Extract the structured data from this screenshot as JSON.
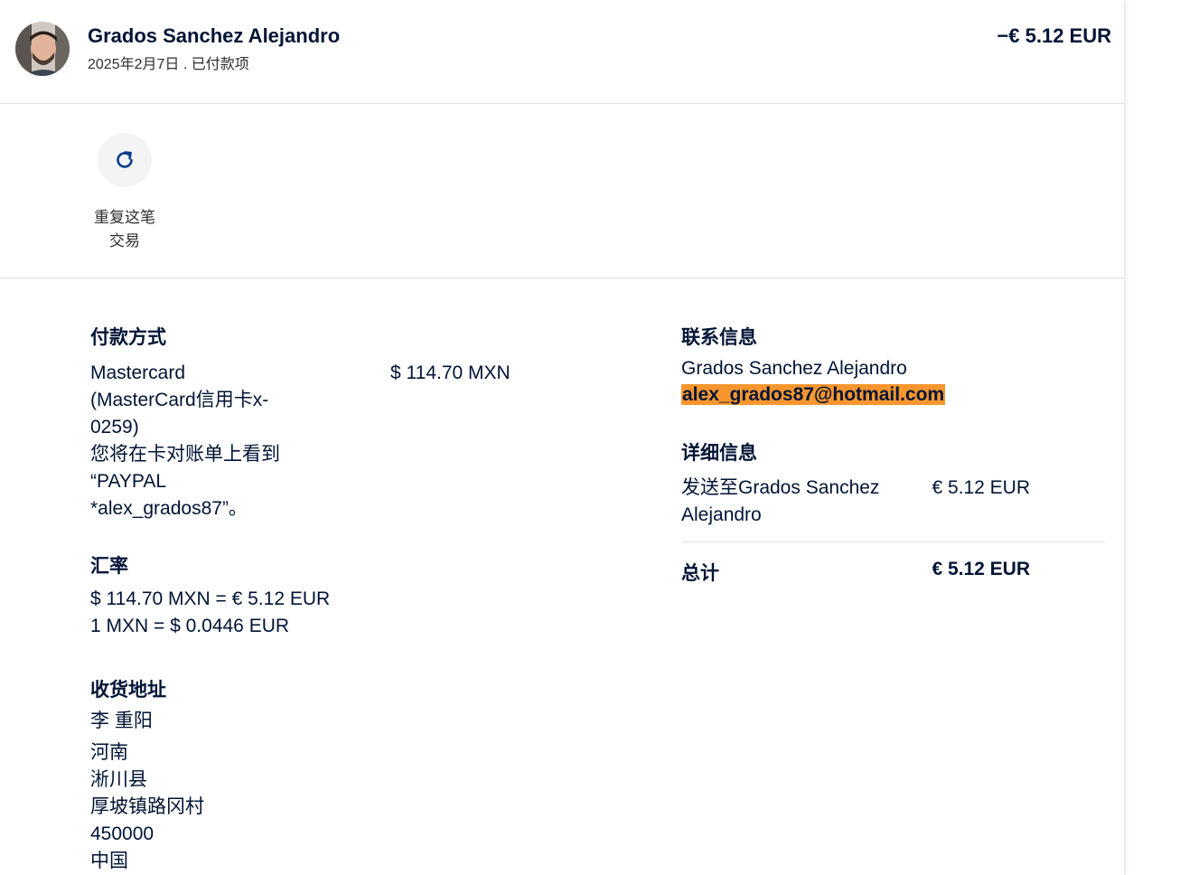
{
  "header": {
    "name": "Grados Sanchez Alejandro",
    "subtitle": "2025年2月7日 . 已付款项",
    "amount": "−€ 5.12 EUR"
  },
  "actions": {
    "repeat_line1": "重复这笔",
    "repeat_line2": "交易"
  },
  "payment": {
    "title": "付款方式",
    "lines": [
      "Mastercard",
      "(MasterCard信用卡x-",
      "0259)",
      "您将在卡对账单上看到",
      "“PAYPAL",
      "*alex_grados87”。"
    ],
    "amount": "$ 114.70 MXN"
  },
  "rate": {
    "title": "汇率",
    "line1": "$ 114.70 MXN = € 5.12 EUR",
    "line2": "1 MXN = $ 0.0446 EUR"
  },
  "shipping": {
    "title": "收货地址",
    "lines": [
      "李 重阳",
      "河南",
      "淅川县",
      "厚坡镇路冈村",
      "450000",
      "中国"
    ]
  },
  "contact": {
    "title": "联系信息",
    "name": "Grados Sanchez Alejandro",
    "email": "alex_grados87@hotmail.com"
  },
  "details": {
    "title": "详细信息",
    "sent_line1": "发送至Grados Sanchez",
    "sent_line2": "Alejandro",
    "sent_amount": "€ 5.12 EUR",
    "total_label": "总计",
    "total_amount": "€ 5.12 EUR"
  }
}
